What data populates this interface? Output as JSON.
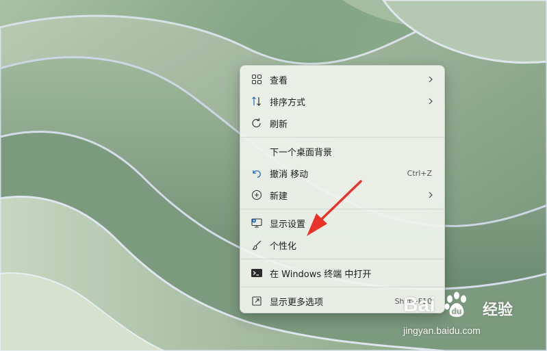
{
  "context_menu": {
    "items": [
      {
        "label": "查看",
        "icon": "view-grid-icon",
        "has_submenu": true
      },
      {
        "label": "排序方式",
        "icon": "sort-icon",
        "has_submenu": true
      },
      {
        "label": "刷新",
        "icon": "refresh-icon",
        "has_submenu": false
      },
      {
        "label": "下一个桌面背景",
        "icon": "",
        "has_submenu": false
      },
      {
        "label": "撤消 移动",
        "icon": "undo-icon",
        "shortcut": "Ctrl+Z"
      },
      {
        "label": "新建",
        "icon": "new-plus-icon",
        "has_submenu": true
      },
      {
        "label": "显示设置",
        "icon": "display-settings-icon",
        "has_submenu": false
      },
      {
        "label": "个性化",
        "icon": "personalize-brush-icon",
        "has_submenu": false
      },
      {
        "label": "在 Windows 终端 中打开",
        "icon": "terminal-icon",
        "has_submenu": false
      },
      {
        "label": "显示更多选项",
        "icon": "more-options-icon",
        "shortcut": "Shift+F10"
      }
    ]
  },
  "annotation": {
    "arrow_color": "#e8322a"
  },
  "watermark": {
    "brand": "Bai 经验",
    "brand_prefix": "Bai",
    "brand_suffix": "经验",
    "url": "jingyan.baidu.com"
  },
  "colors": {
    "accent_blue": "#1b6ac9",
    "menu_bg": "#f0f4ee"
  }
}
